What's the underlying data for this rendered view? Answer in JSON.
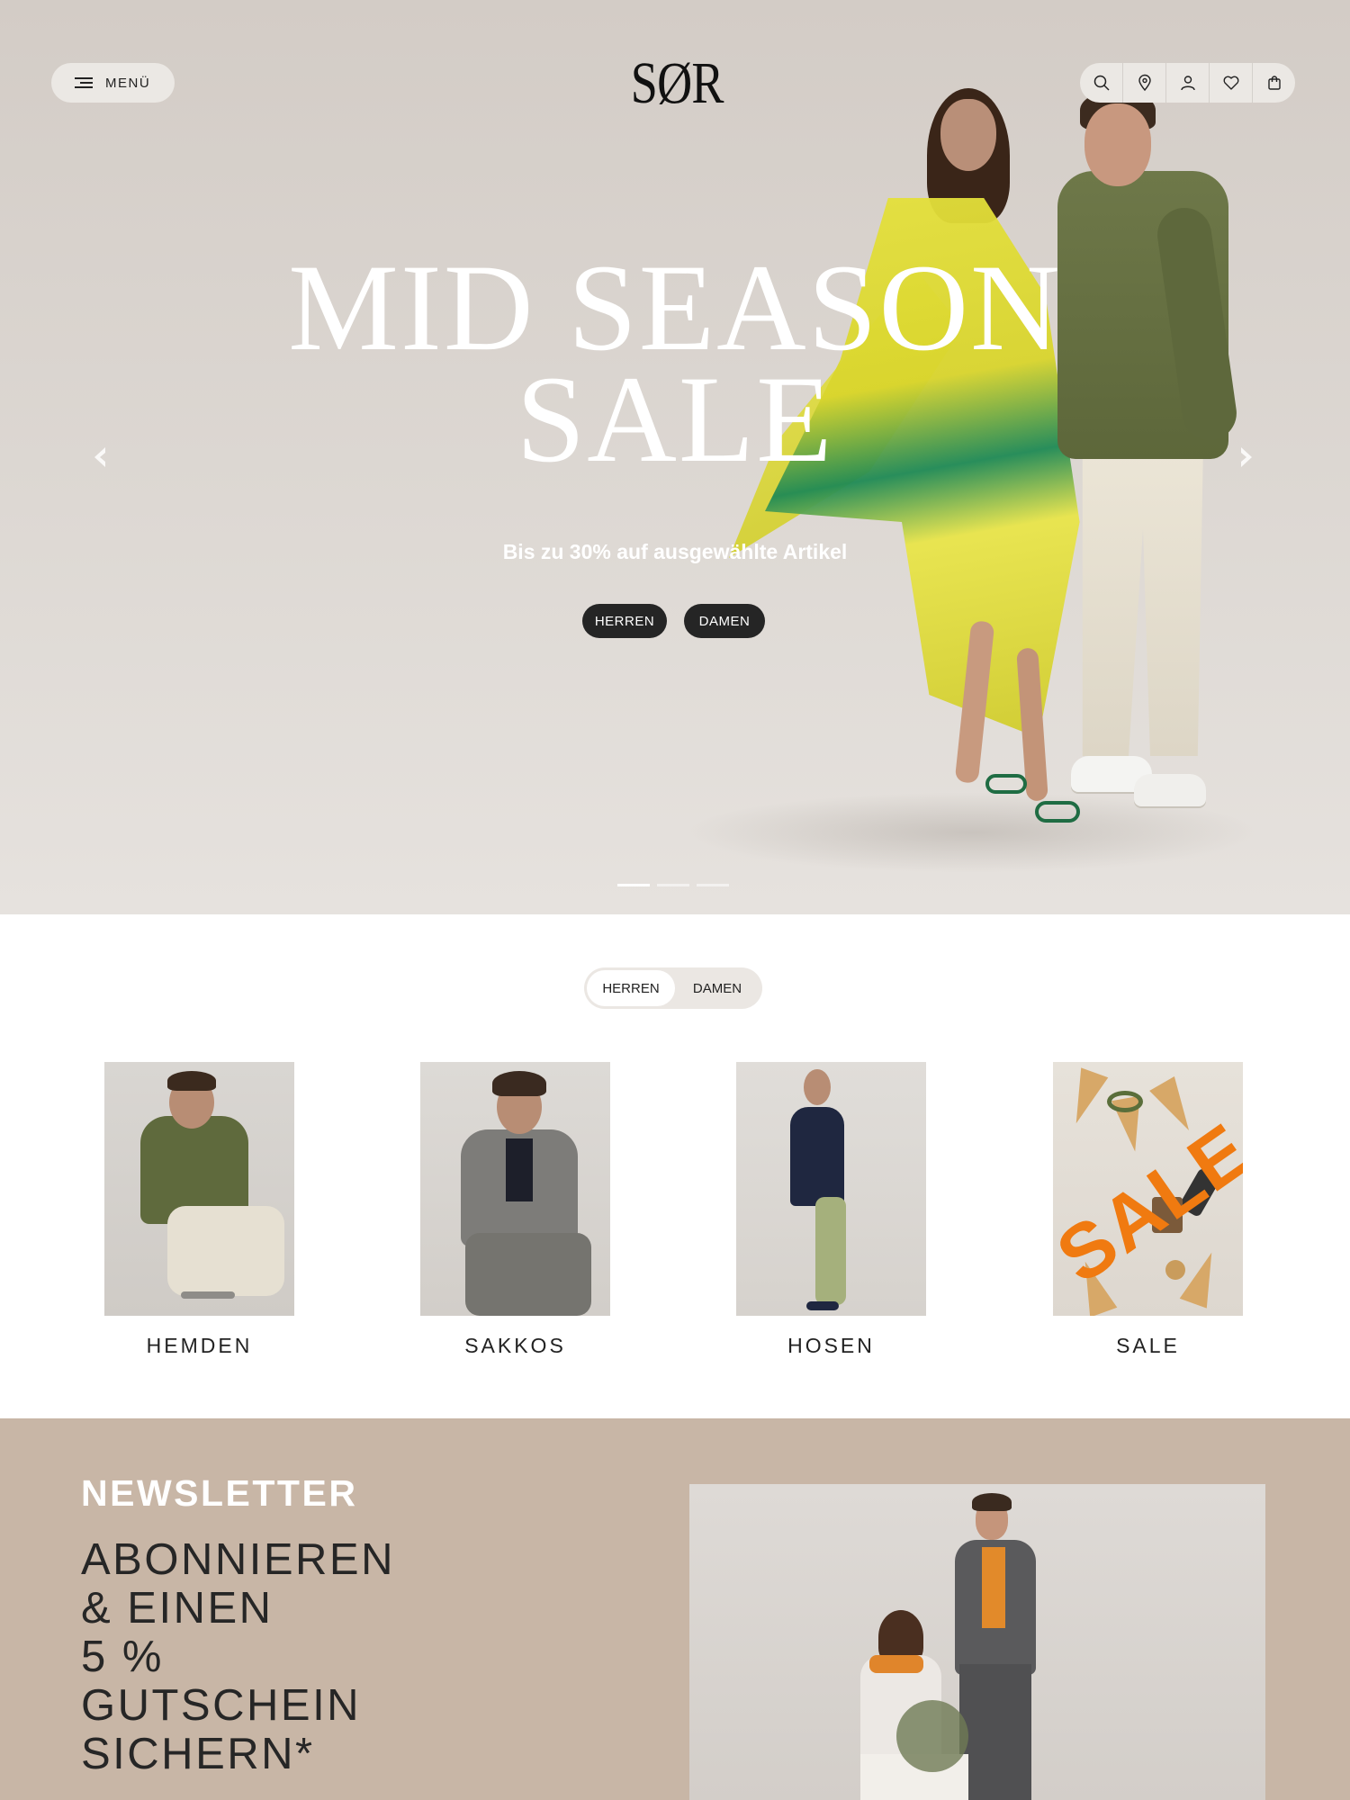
{
  "header": {
    "menu_label": "MENÜ",
    "logo": "SØR",
    "icons": [
      "search-icon",
      "location-pin-icon",
      "user-icon",
      "heart-icon",
      "shopping-bag-icon"
    ]
  },
  "hero": {
    "headline_line1": "MID SEASON",
    "headline_line2": "SALE",
    "subline": "Bis zu 30% auf ausgewählte Artikel",
    "button_herren": "HERREN",
    "button_damen": "DAMEN",
    "slides_total": 3,
    "active_slide": 1
  },
  "category_toggle": {
    "options": [
      "HERREN",
      "DAMEN"
    ],
    "active": "HERREN"
  },
  "categories": [
    {
      "label": "HEMDEN"
    },
    {
      "label": "SAKKOS"
    },
    {
      "label": "HOSEN"
    },
    {
      "label": "SALE"
    }
  ],
  "sale_image_text": "SALE",
  "newsletter": {
    "kicker": "NEWSLETTER",
    "title_lines": [
      "ABONNIEREN",
      "& EINEN",
      "5 %",
      "GUTSCHEIN",
      "SICHERN*"
    ]
  },
  "colors": {
    "hero_bg": "#d8d2cc",
    "dark_button": "#252525",
    "newsletter_bg": "#c8b6a6",
    "sale_orange": "#f07a10",
    "olive_shirt": "#5d673a",
    "dress_yellow": "#e5e13c"
  }
}
